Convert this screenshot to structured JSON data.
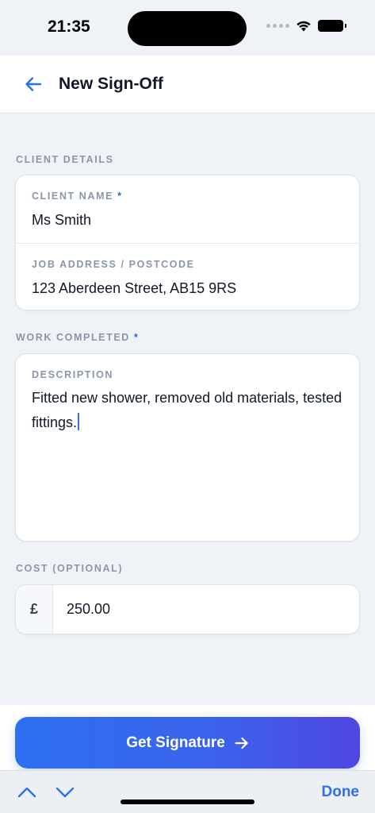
{
  "status_bar": {
    "time": "21:35"
  },
  "header": {
    "title": "New Sign-Off"
  },
  "client_section": {
    "label": "CLIENT DETAILS",
    "client_name": {
      "label": "CLIENT NAME",
      "required_mark": "*",
      "value": "Ms Smith"
    },
    "job_address": {
      "label": "JOB ADDRESS / POSTCODE",
      "value": "123 Aberdeen Street, AB15 9RS"
    }
  },
  "work_section": {
    "label": "WORK COMPLETED",
    "required_mark": "*",
    "description": {
      "label": "DESCRIPTION",
      "value": "Fitted new shower, removed old materials, tested fittings."
    }
  },
  "cost_section": {
    "label": "COST (OPTIONAL)",
    "currency_symbol": "£",
    "value": "250.00"
  },
  "cta": {
    "label": "Get Signature"
  },
  "keyboard_toolbar": {
    "done_label": "Done"
  },
  "colors": {
    "accent": "#2e6ff0",
    "background": "#eff2f7",
    "label_gray": "#8b96a8"
  },
  "icons": {
    "back": "back-arrow-icon",
    "cta": "arrow-right-icon",
    "prev_field": "chevron-up-icon",
    "next_field": "chevron-down-icon",
    "wifi": "wifi-icon",
    "battery": "battery-icon",
    "signal": "signal-icon"
  }
}
